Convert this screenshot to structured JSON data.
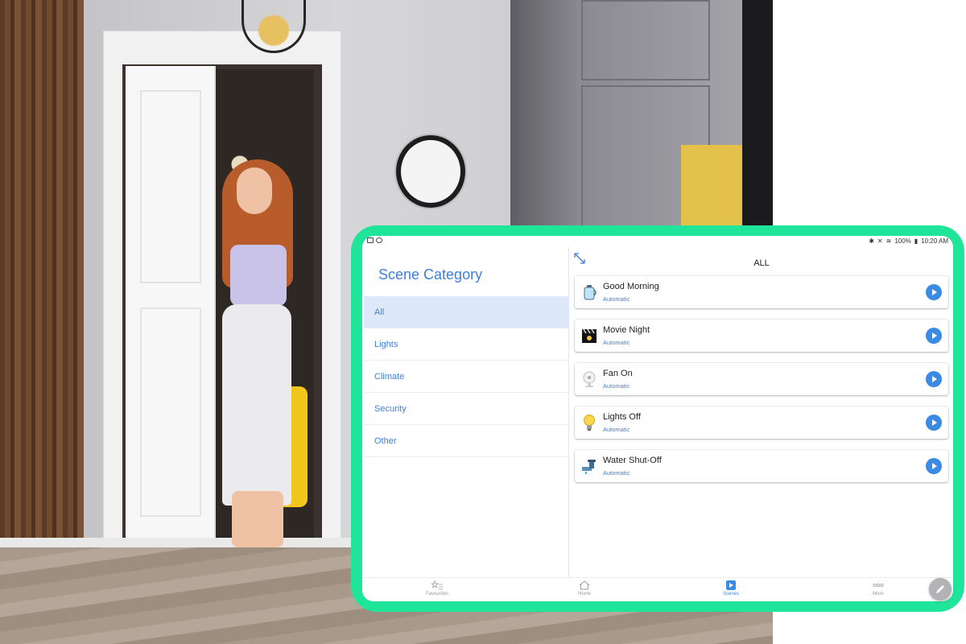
{
  "statusbar": {
    "battery": "100%",
    "time": "10:20 AM",
    "left_icons": [
      "image-icon",
      "account-icon"
    ],
    "right_icons": [
      "bluetooth-icon",
      "mute-icon",
      "wifi-icon",
      "battery-icon"
    ]
  },
  "sidebar": {
    "title": "Scene Category",
    "categories": [
      {
        "label": "All",
        "selected": true
      },
      {
        "label": "Lights",
        "selected": false
      },
      {
        "label": "Climate",
        "selected": false
      },
      {
        "label": "Security",
        "selected": false
      },
      {
        "label": "Other",
        "selected": false
      }
    ]
  },
  "main": {
    "title": "ALL",
    "scenes": [
      {
        "name": "Good Morning",
        "subtitle": "Automatic",
        "icon": "kettle-icon"
      },
      {
        "name": "Movie Night",
        "subtitle": "Automatic",
        "icon": "clapperboard-icon"
      },
      {
        "name": "Fan On",
        "subtitle": "Automatic",
        "icon": "fan-icon"
      },
      {
        "name": "Lights Off",
        "subtitle": "Automatic",
        "icon": "lightbulb-icon"
      },
      {
        "name": "Water Shut-Off",
        "subtitle": "Automatic",
        "icon": "water-valve-icon"
      }
    ]
  },
  "bottom_nav": [
    {
      "label": "Favourites",
      "icon": "star-list-icon",
      "active": false
    },
    {
      "label": "Home",
      "icon": "home-icon",
      "active": false
    },
    {
      "label": "Scenes",
      "icon": "play-square-icon",
      "active": true
    },
    {
      "label": "More",
      "icon": "more-dots-icon",
      "active": false
    }
  ],
  "colors": {
    "accent": "#3f7fe0",
    "play": "#3a8be3",
    "tablet_bezel": "#1fe59a",
    "selected_row": "#dde9fb"
  }
}
